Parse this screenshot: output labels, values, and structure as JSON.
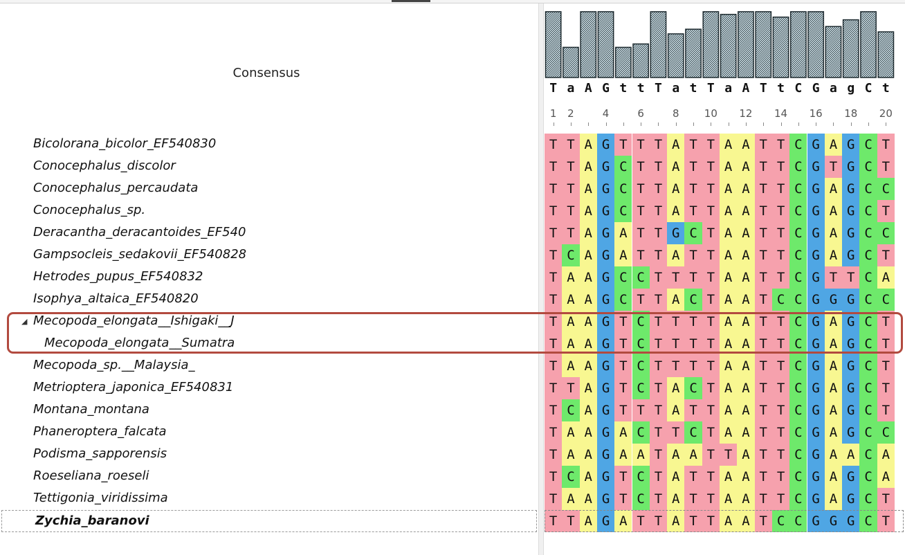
{
  "consensus_label": "Consensus",
  "consensus_sequence": [
    "T",
    "a",
    "A",
    "G",
    "t",
    "t",
    "T",
    "a",
    "t",
    "T",
    "a",
    "A",
    "T",
    "t",
    "C",
    "G",
    "a",
    "g",
    "C",
    "t"
  ],
  "conservation": [
    0.98,
    0.45,
    0.98,
    0.98,
    0.45,
    0.5,
    0.98,
    0.65,
    0.72,
    0.98,
    0.94,
    0.98,
    0.98,
    0.9,
    0.98,
    0.98,
    0.76,
    0.86,
    0.98,
    0.68
  ],
  "ruler_labels": [
    "1",
    "2",
    "4",
    "6",
    "8",
    "10",
    "12",
    "14",
    "16",
    "18",
    "20"
  ],
  "base_colors": {
    "T": "#f6a1ad",
    "A": "#f8f791",
    "G": "#4fa6e4",
    "C": "#6ee96b"
  },
  "sequences": [
    {
      "name": "Bicolorana_bicolor_EF540830",
      "seq": "TTAGTTTATTAATTCGAGCT"
    },
    {
      "name": "Conocephalus_discolor",
      "seq": "TTAGCTTATTAATTCGTGCT"
    },
    {
      "name": "Conocephalus_percaudata",
      "seq": "TTAGCTTATTAATTCGAGCC"
    },
    {
      "name": "Conocephalus_sp.",
      "seq": "TTAGCTTATTAATTCGAGCT"
    },
    {
      "name": "Deracantha_deracantoides_EF540",
      "seq": "TTAGATTGCTAATTCGAGCC"
    },
    {
      "name": "Gampsocleis_sedakovii_EF540828",
      "seq": "TCAGATTATTAATTCGAGCT"
    },
    {
      "name": "Hetrodes_pupus_EF540832",
      "seq": "TAAGCCTTTTAATTCGTTCA"
    },
    {
      "name": "Isophya_altaica_EF540820",
      "seq": "TAAGCTTACTAATCCGGGCC"
    },
    {
      "name": "Mecopoda_elongata__Ishigaki__J",
      "seq": "TAAGTCTTTTAATTCGAGCT",
      "expander": "◢"
    },
    {
      "name": "Mecopoda_elongata__Sumatra",
      "seq": "TAAGTCTTTTAATTCGAGCT",
      "child": true
    },
    {
      "name": "Mecopoda_sp.__Malaysia_",
      "seq": "TAAGTCTTTTAATTCGAGCT"
    },
    {
      "name": "Metrioptera_japonica_EF540831",
      "seq": "TTAGTCTACTAATTCGAGCT"
    },
    {
      "name": "Montana_montana",
      "seq": "TCAGTTTATTAATTCGAGCT"
    },
    {
      "name": "Phaneroptera_falcata",
      "seq": "TAAGACTTCTAATTCGAGCC"
    },
    {
      "name": "Podisma_sapporensis",
      "seq": "TAAGAATAATTATTCGAACA"
    },
    {
      "name": "Roeseliana_roeseli",
      "seq": "TCAGTCTATTAATTCGAGCA"
    },
    {
      "name": "Tettigonia_viridissima",
      "seq": "TAAGTCTATTAATTCGAGCT"
    },
    {
      "name": "Zychia_baranovi",
      "seq": "TTAGATTATTAATCCGGGCT",
      "selected": true
    }
  ]
}
